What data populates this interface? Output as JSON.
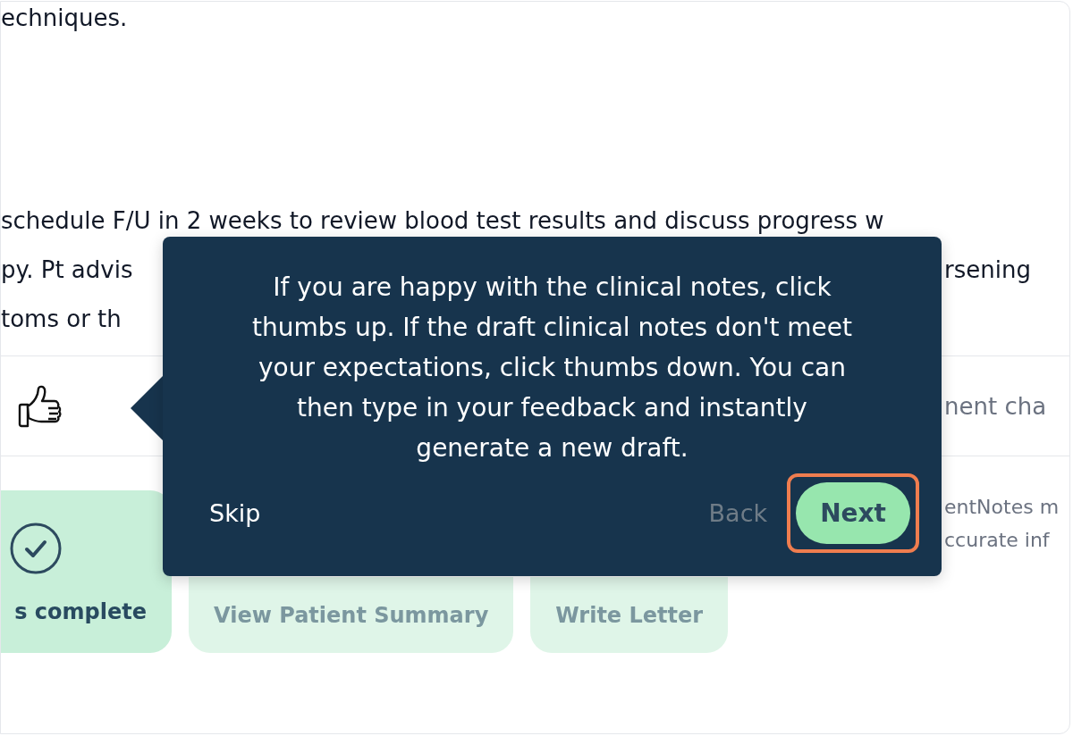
{
  "notes": [
    {
      "lines": [
        {
          "text": "echniques."
        }
      ]
    },
    {
      "lines": [
        {
          "text": "schedule F/U in 2 weeks to review blood test results and discuss progress w"
        },
        {
          "text": "py. Pt advis",
          "right_fragment": "rsening"
        },
        {
          "text": "toms or th"
        }
      ]
    }
  ],
  "feedback_row": {
    "right_fragment": "nent cha"
  },
  "actions": [
    {
      "kind": "complete",
      "label": "s complete",
      "disabled": false
    },
    {
      "kind": "plain",
      "label": "View Patient Summary",
      "disabled": true
    },
    {
      "kind": "plain",
      "label": "Write Letter",
      "disabled": true
    }
  ],
  "disclaimer_lines": [
    "entNotes m",
    "ccurate inf"
  ],
  "tour_popover": {
    "message": "If you are happy with the clinical notes, click thumbs up. If the draft clinical notes don't meet your expectations, click thumbs down. You can then type in your feedback and instantly generate a new draft.",
    "buttons": [
      {
        "kind": "link",
        "label": "Skip",
        "disabled": false
      },
      {
        "kind": "link",
        "label": "Back",
        "disabled": true
      },
      {
        "kind": "primary",
        "label": "Next",
        "disabled": false,
        "highlighted": true
      }
    ]
  }
}
